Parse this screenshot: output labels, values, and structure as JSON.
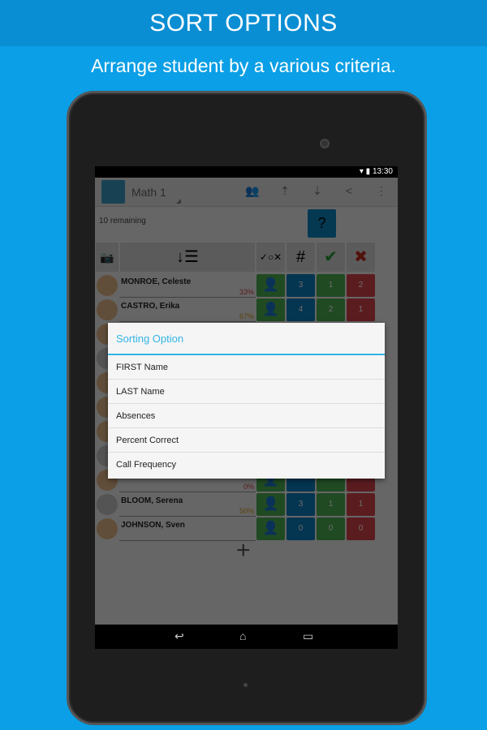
{
  "banner": {
    "title": "SORT OPTIONS",
    "subtitle": "Arrange student by a various criteria."
  },
  "status": {
    "time": "13:30"
  },
  "actionbar": {
    "class_name": "Math 1",
    "icons": [
      "group-icon",
      "upload-icon",
      "download-icon",
      "share-icon",
      "overflow-menu-icon"
    ]
  },
  "remaining": "10 remaining",
  "headers": {
    "number": "#",
    "correct": "✔",
    "wrong": "✖"
  },
  "students": [
    {
      "name": "MONROE, Celeste",
      "pct": "33%",
      "pct_color": "#d9434b",
      "calls": "3",
      "correct": "1",
      "wrong": "2"
    },
    {
      "name": "CASTRO, Erika",
      "pct": "67%",
      "pct_color": "#d4a017",
      "calls": "4",
      "correct": "2",
      "wrong": "1"
    },
    {
      "name": "",
      "pct": "",
      "calls": "",
      "correct": "",
      "wrong": ""
    },
    {
      "name": "",
      "pct": "",
      "calls": "",
      "correct": "",
      "wrong": "",
      "gray": true
    },
    {
      "name": "",
      "pct": "",
      "calls": "",
      "correct": "",
      "wrong": ""
    },
    {
      "name": "",
      "pct": "",
      "calls": "",
      "correct": "",
      "wrong": ""
    },
    {
      "name": "",
      "pct": "",
      "calls": "",
      "correct": "",
      "wrong": ""
    },
    {
      "name": "",
      "pct": "",
      "calls": "",
      "correct": "",
      "wrong": "",
      "gray": true
    },
    {
      "name": "",
      "pct": "0%",
      "pct_color": "#d9434b",
      "calls": "",
      "correct": "",
      "wrong": ""
    },
    {
      "name": "BLOOM, Serena",
      "pct": "50%",
      "pct_color": "#d4a017",
      "calls": "3",
      "correct": "1",
      "wrong": "1",
      "gray": true
    },
    {
      "name": "JOHNSON, Sven",
      "pct": "",
      "calls": "0",
      "correct": "0",
      "wrong": "0"
    }
  ],
  "dialog": {
    "title": "Sorting Option",
    "options": [
      "FIRST Name",
      "LAST Name",
      "Absences",
      "Percent Correct",
      "Call Frequency"
    ]
  }
}
